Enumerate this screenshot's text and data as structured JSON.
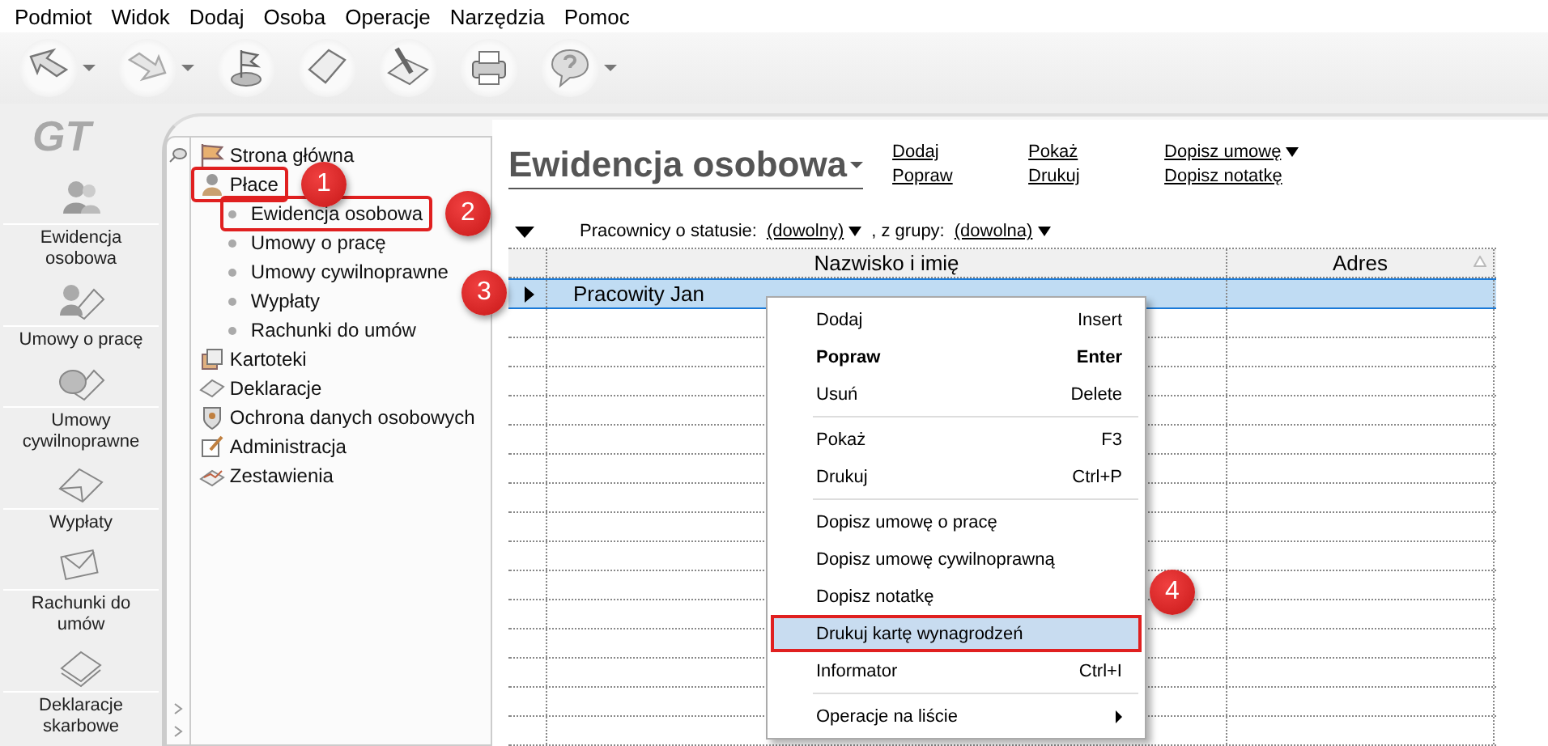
{
  "menu_bar": [
    {
      "label": "Podmiot"
    },
    {
      "label": "Widok"
    },
    {
      "label": "Dodaj"
    },
    {
      "label": "Osoba"
    },
    {
      "label": "Operacje"
    },
    {
      "label": "Narzędzia"
    },
    {
      "label": "Pomoc"
    }
  ],
  "toolbar": [
    {
      "kind": "back",
      "dropdown": true
    },
    {
      "kind": "forward",
      "dropdown": true
    },
    {
      "kind": "flag",
      "dropdown": false
    },
    {
      "kind": "tag",
      "dropdown": false
    },
    {
      "kind": "pen",
      "dropdown": false
    },
    {
      "kind": "printer",
      "dropdown": false
    },
    {
      "kind": "help",
      "dropdown": true
    }
  ],
  "logo": "GT",
  "shortcuts": [
    {
      "label": "Ewidencja osobowa",
      "kind": "people"
    },
    {
      "label": "Umowy o pracę",
      "kind": "contract"
    },
    {
      "label": "Umowy cywilnoprawne",
      "kind": "coin"
    },
    {
      "label": "Wypłaty",
      "kind": "envelopes"
    },
    {
      "label": "Rachunki do umów",
      "kind": "envelope"
    },
    {
      "label": "Deklaracje skarbowe",
      "kind": "papers"
    }
  ],
  "tree": [
    {
      "label": "Strona główna",
      "kind": "home",
      "highlighted": false
    },
    {
      "label": "Płace",
      "kind": "person",
      "highlighted": true,
      "callout": "1",
      "children": [
        {
          "label": "Ewidencja osobowa",
          "highlighted": true,
          "callout": "2"
        },
        {
          "label": "Umowy o pracę",
          "highlighted": false
        },
        {
          "label": "Umowy cywilnoprawne",
          "highlighted": false
        },
        {
          "label": "Wypłaty",
          "highlighted": false
        },
        {
          "label": "Rachunki do umów",
          "highlighted": false
        }
      ]
    },
    {
      "label": "Kartoteki",
      "kind": "cards",
      "highlighted": false
    },
    {
      "label": "Deklaracje",
      "kind": "tag",
      "highlighted": false
    },
    {
      "label": "Ochrona danych osobowych",
      "kind": "shield",
      "highlighted": false
    },
    {
      "label": "Administracja",
      "kind": "edit",
      "highlighted": false
    },
    {
      "label": "Zestawienia",
      "kind": "chart",
      "highlighted": false
    }
  ],
  "content": {
    "title": "Ewidencja osobowa",
    "actions": [
      [
        {
          "label": "Dodaj",
          "dropdown": false
        },
        {
          "label": "Popraw",
          "dropdown": false
        }
      ],
      [
        {
          "label": "Pokaż",
          "dropdown": false
        },
        {
          "label": "Drukuj",
          "dropdown": false
        }
      ],
      [
        {
          "label": "Dopisz umowę",
          "dropdown": true
        },
        {
          "label": "Dopisz notatkę",
          "dropdown": false
        }
      ]
    ],
    "filter": {
      "status_label": "Pracownicy o statusie:",
      "status_value": "(dowolny)",
      "group_label": ", z grupy:",
      "group_value": "(dowolna)"
    },
    "table": {
      "columns": [
        {
          "label": "Nazwisko i imię"
        },
        {
          "label": "Adres"
        }
      ],
      "rows": [
        {
          "cells": [
            "Pracowity Jan",
            ""
          ],
          "selected": true,
          "callout": "3"
        }
      ]
    },
    "context_menu": [
      {
        "kind": "item",
        "label": "Dodaj",
        "shortcut": "Insert",
        "bold": false,
        "selected": false
      },
      {
        "kind": "item",
        "label": "Popraw",
        "shortcut": "Enter",
        "bold": true,
        "selected": false
      },
      {
        "kind": "item",
        "label": "Usuń",
        "shortcut": "Delete",
        "bold": false,
        "selected": false
      },
      {
        "kind": "separator"
      },
      {
        "kind": "item",
        "label": "Pokaż",
        "shortcut": "F3",
        "bold": false,
        "selected": false
      },
      {
        "kind": "item",
        "label": "Drukuj",
        "shortcut": "Ctrl+P",
        "bold": false,
        "selected": false
      },
      {
        "kind": "separator"
      },
      {
        "kind": "item",
        "label": "Dopisz umowę o pracę",
        "bold": false,
        "selected": false
      },
      {
        "kind": "item",
        "label": "Dopisz umowę cywilnoprawną",
        "bold": false,
        "selected": false
      },
      {
        "kind": "item",
        "label": "Dopisz notatkę",
        "bold": false,
        "selected": false,
        "callout": "4"
      },
      {
        "kind": "item",
        "label": "Drukuj kartę wynagrodzeń",
        "bold": false,
        "selected": true
      },
      {
        "kind": "item",
        "label": "Informator",
        "shortcut": "Ctrl+I",
        "bold": false,
        "selected": false
      },
      {
        "kind": "separator"
      },
      {
        "kind": "submenu",
        "label": "Operacje na liście",
        "bold": false,
        "selected": false
      }
    ]
  }
}
